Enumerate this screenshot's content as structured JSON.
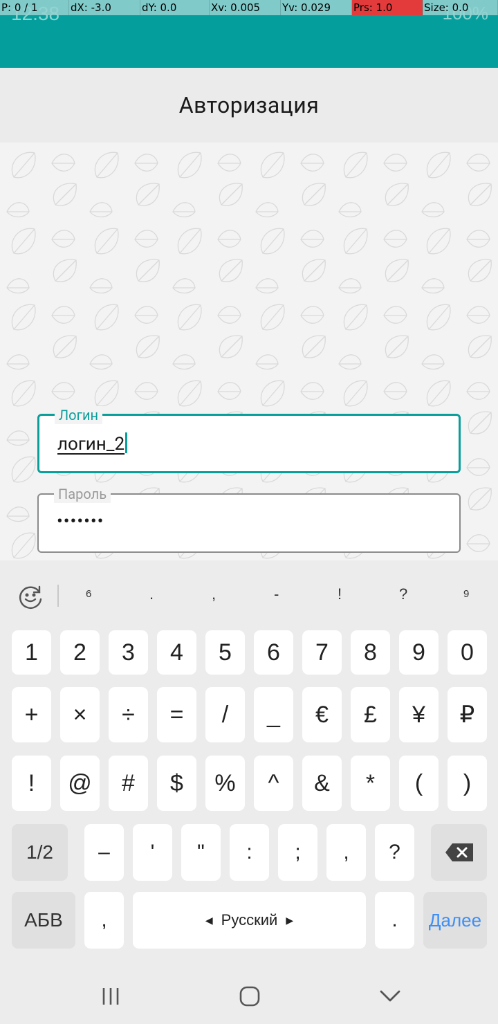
{
  "status_bar": {
    "time": "12:38",
    "battery": "100%",
    "debug": [
      {
        "label": "P: 0 / 1"
      },
      {
        "label": "dX: -3.0"
      },
      {
        "label": "dY: 0.0"
      },
      {
        "label": "Xv: 0.005"
      },
      {
        "label": "Yv: 0.029"
      },
      {
        "label": "Prs: 1.0",
        "highlight": true
      },
      {
        "label": "Size: 0.0"
      }
    ]
  },
  "header": {
    "title": "Авторизация"
  },
  "form": {
    "login": {
      "label": "Логин",
      "value": "логин_2"
    },
    "password": {
      "label": "Пароль",
      "value": "•••••••"
    }
  },
  "keyboard": {
    "suggestions": [
      "6",
      ".",
      ",",
      "-",
      "!",
      "?",
      "9"
    ],
    "row1": [
      "1",
      "2",
      "3",
      "4",
      "5",
      "6",
      "7",
      "8",
      "9",
      "0"
    ],
    "row2": [
      "+",
      "×",
      "÷",
      "=",
      "/",
      "_",
      "€",
      "£",
      "¥",
      "₽"
    ],
    "row3": [
      "!",
      "@",
      "#",
      "$",
      "%",
      "^",
      "&",
      "*",
      "(",
      ")"
    ],
    "row4": {
      "toggle": "1/2",
      "keys": [
        "–",
        "'",
        "\"",
        ":",
        ";",
        ",",
        "?"
      ]
    },
    "row5": {
      "abc": "АБВ",
      "comma": ",",
      "space": "Русский",
      "period": ".",
      "next": "Далее"
    }
  },
  "colors": {
    "accent": "#049f9c",
    "action_blue": "#3d8ef5"
  },
  "icons": {
    "suggestions": "emoji-rotate-icon",
    "backspace": "backspace-icon",
    "nav": [
      "recents-icon",
      "home-icon",
      "back-icon"
    ]
  }
}
